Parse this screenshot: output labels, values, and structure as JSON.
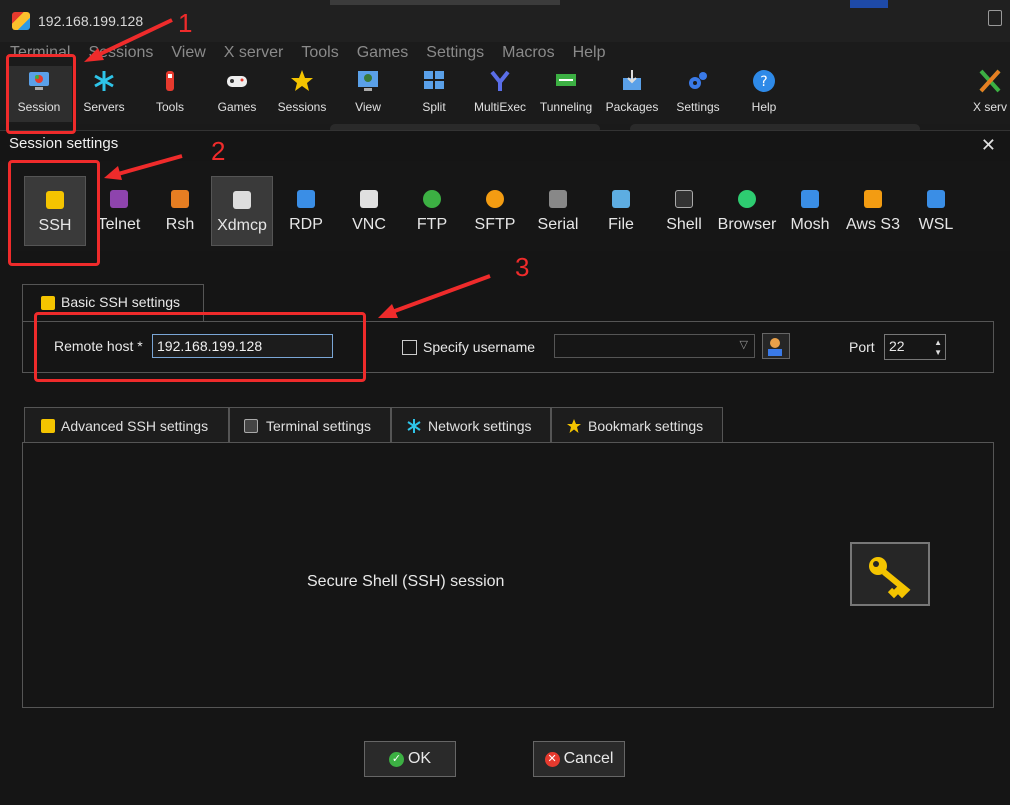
{
  "window": {
    "title": "192.168.199.128"
  },
  "menu": [
    "Terminal",
    "Sessions",
    "View",
    "X server",
    "Tools",
    "Games",
    "Settings",
    "Macros",
    "Help"
  ],
  "toolbar": [
    {
      "label": "Session",
      "icon": "session-icon"
    },
    {
      "label": "Servers",
      "icon": "servers-icon"
    },
    {
      "label": "Tools",
      "icon": "tools-icon"
    },
    {
      "label": "Games",
      "icon": "games-icon"
    },
    {
      "label": "Sessions",
      "icon": "star-icon"
    },
    {
      "label": "View",
      "icon": "view-icon"
    },
    {
      "label": "Split",
      "icon": "split-icon"
    },
    {
      "label": "MultiExec",
      "icon": "multiexec-icon"
    },
    {
      "label": "Tunneling",
      "icon": "tunneling-icon"
    },
    {
      "label": "Packages",
      "icon": "packages-icon"
    },
    {
      "label": "Settings",
      "icon": "gears-icon"
    },
    {
      "label": "Help",
      "icon": "help-icon"
    },
    {
      "label": "X serv",
      "icon": "xserver-icon"
    }
  ],
  "dialog": {
    "title": "Session settings",
    "close": "✕",
    "protocols": [
      {
        "label": "SSH",
        "color": "#f4c400"
      },
      {
        "label": "Telnet",
        "color": "#8e44ad"
      },
      {
        "label": "Rsh",
        "color": "#e67e22"
      },
      {
        "label": "Xdmcp",
        "color": "#dddddd"
      },
      {
        "label": "RDP",
        "color": "#3a8ee6"
      },
      {
        "label": "VNC",
        "color": "#e0e0e0"
      },
      {
        "label": "FTP",
        "color": "#3cb043"
      },
      {
        "label": "SFTP",
        "color": "#f39c12"
      },
      {
        "label": "Serial",
        "color": "#888888"
      },
      {
        "label": "File",
        "color": "#5dade2"
      },
      {
        "label": "Shell",
        "color": "#333333"
      },
      {
        "label": "Browser",
        "color": "#2ecc71"
      },
      {
        "label": "Mosh",
        "color": "#3a8ee6"
      },
      {
        "label": "Aws S3",
        "color": "#f39c12"
      },
      {
        "label": "WSL",
        "color": "#3a8ee6"
      }
    ],
    "basic_tab": "Basic SSH settings",
    "remote_host_label": "Remote host *",
    "remote_host_value": "192.168.199.128",
    "specify_username_label": "Specify username",
    "port_label": "Port",
    "port_value": "22",
    "lower_tabs": [
      "Advanced SSH settings",
      "Terminal settings",
      "Network settings",
      "Bookmark settings"
    ],
    "description": "Secure Shell (SSH) session",
    "ok": "OK",
    "cancel": "Cancel"
  },
  "annotations": [
    "1",
    "2",
    "3"
  ],
  "colors": {
    "accent_red": "#ef2b2b",
    "key_yellow": "#f4c400"
  }
}
